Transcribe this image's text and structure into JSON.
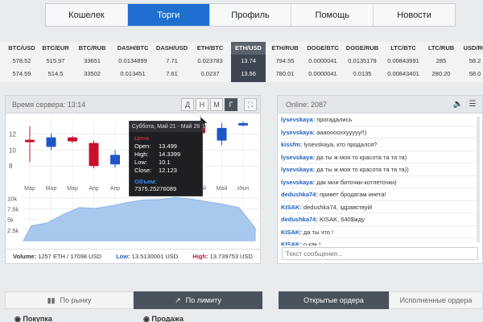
{
  "nav": {
    "tabs": [
      {
        "label": "Кошелек",
        "active": false
      },
      {
        "label": "Торги",
        "active": true
      },
      {
        "label": "Профиль",
        "active": false
      },
      {
        "label": "Помощь",
        "active": false
      },
      {
        "label": "Новости",
        "active": false
      }
    ]
  },
  "ticker": [
    {
      "pair": "BTC/USD",
      "v1": "578.52",
      "v2": "574.59",
      "selected": false
    },
    {
      "pair": "BTC/EUR",
      "v1": "515.97",
      "v2": "514.5",
      "selected": false
    },
    {
      "pair": "BTC/RUB",
      "v1": "33651",
      "v2": "33502",
      "selected": false
    },
    {
      "pair": "DASH/BTC",
      "v1": "0.0134899",
      "v2": "0.013451",
      "selected": false
    },
    {
      "pair": "DASH/USD",
      "v1": "7.71",
      "v2": "7.61",
      "selected": false
    },
    {
      "pair": "ETH/BTC",
      "v1": "0.023783",
      "v2": "0.0237",
      "selected": false
    },
    {
      "pair": "ETH/USD",
      "v1": "13.74",
      "v2": "13.56",
      "selected": true
    },
    {
      "pair": "ETH/RUB",
      "v1": "794.55",
      "v2": "780.01",
      "selected": false
    },
    {
      "pair": "DOGE/BTC",
      "v1": "0.0000041",
      "v2": "0.0000041",
      "selected": false
    },
    {
      "pair": "DOGE/RUB",
      "v1": "0.0135179",
      "v2": "0.0135",
      "selected": false
    },
    {
      "pair": "LTC/BTC",
      "v1": "0.00843991",
      "v2": "0.00843401",
      "selected": false
    },
    {
      "pair": "LTC/RUB",
      "v1": "285",
      "v2": "280.20",
      "selected": false
    },
    {
      "pair": "USD/RU",
      "v1": "58.2",
      "v2": "58.0",
      "selected": false
    }
  ],
  "chart_panel": {
    "server_time": "Время сервера: 13:14",
    "periods": [
      {
        "label": "Д",
        "active": false
      },
      {
        "label": "Н",
        "active": false
      },
      {
        "label": "М",
        "active": false
      },
      {
        "label": "Г",
        "active": true
      }
    ],
    "expand_icon": "expand-icon",
    "footer": {
      "volume_label": "Volume:",
      "volume_value": "1257 ETH / 17098 USD",
      "low_label": "Low:",
      "low_value": "13.5130001 USD",
      "high_label": "High:",
      "high_value": "13.739753 USD"
    },
    "tooltip": {
      "header": "Суббота, Май 21 - Май 28",
      "price_label": "Цена",
      "rows": [
        {
          "k": "Open:",
          "v": "13.499"
        },
        {
          "k": "High:",
          "v": "14.3399"
        },
        {
          "k": "Low:",
          "v": "10.1"
        },
        {
          "k": "Close:",
          "v": "12.123"
        }
      ],
      "volume_label": "Объем:",
      "volume_value": "7375.25276089"
    }
  },
  "chart_data": {
    "type": "candlestick",
    "price_axis": {
      "ticks": [
        12,
        10,
        8
      ],
      "ylim": [
        6.5,
        14
      ]
    },
    "volume_axis": {
      "ticks": [
        "10k",
        "7.5k",
        "5k",
        "2.5k"
      ],
      "ylim": [
        0,
        11000
      ]
    },
    "x_labels": [
      "Мар",
      "Мар",
      "Мар",
      "Апр",
      "Апр",
      "Апр",
      "Май",
      "Май",
      "Май",
      "Май",
      "Июн"
    ],
    "candles": [
      {
        "open": 11.0,
        "close": 11.3,
        "high": 13.0,
        "low": 8.5,
        "color": "#c8102e"
      },
      {
        "open": 10.4,
        "close": 11.6,
        "high": 12.1,
        "low": 10.0,
        "color": "#1e56c8"
      },
      {
        "open": 11.6,
        "close": 11.1,
        "high": 11.8,
        "low": 10.9,
        "color": "#c8102e"
      },
      {
        "open": 10.9,
        "close": 8.0,
        "high": 11.2,
        "low": 7.7,
        "color": "#c8102e"
      },
      {
        "open": 8.2,
        "close": 9.4,
        "high": 10.0,
        "low": 7.8,
        "color": "#1e56c8"
      },
      {
        "open": 9.0,
        "close": 8.1,
        "high": 9.4,
        "low": 7.9,
        "color": "#c8102e"
      },
      {
        "open": 9.5,
        "close": 11.0,
        "high": 12.0,
        "low": 9.0,
        "color": "#1e56c8"
      },
      {
        "open": 11.5,
        "close": 12.8,
        "high": 13.5,
        "low": 11.0,
        "color": "#1e56c8"
      },
      {
        "open": 13.499,
        "close": 12.123,
        "high": 14.3399,
        "low": 10.1,
        "color": "#c8102e"
      },
      {
        "open": 11.2,
        "close": 12.8,
        "high": 13.4,
        "low": 10.6,
        "color": "#1e56c8"
      },
      {
        "open": 13.1,
        "close": 13.4,
        "high": 13.6,
        "low": 13.0,
        "color": "#1e56c8"
      }
    ],
    "volume": [
      3500,
      4200,
      6200,
      7800,
      7600,
      8200,
      9000,
      9600,
      9700,
      10200,
      9800,
      9200,
      8600,
      7800,
      3000
    ]
  },
  "chat": {
    "online": "Online: 2087",
    "sound_icon": "speaker-icon",
    "menu_icon": "menu-icon",
    "messages": [
      {
        "nick": "lysevskaya:",
        "text": " прогадались"
      },
      {
        "nick": "lysevskaya:",
        "text": " аааооооххууууу!!)"
      },
      {
        "nick": "kissfm:",
        "text": " lysevskaya, кто продался?"
      },
      {
        "nick": "lysevskaya:",
        "text": " да ты ж моя то красота та та та)"
      },
      {
        "nick": "lysevskaya:",
        "text": " да ты ж моя то красота та та та))"
      },
      {
        "nick": "lysevskaya:",
        "text": " дак мои биточки-котлеточки)"
      },
      {
        "nick": "dedushka74:",
        "text": " привет бродягам инета!"
      },
      {
        "nick": "KISAK:",
        "text": " dedushka74, здравствуй!"
      },
      {
        "nick": "dedushka74:",
        "text": " KISAK, 640$жду"
      },
      {
        "nick": "KISAK:",
        "text": " да ты что !"
      },
      {
        "nick": "KISAK:",
        "text": " о как !"
      }
    ],
    "input_placeholder": "Текст сообщения..."
  },
  "bottom": {
    "tabs": [
      {
        "label": "По рынку",
        "icon": "bar-chart-icon",
        "active": false
      },
      {
        "label": "По лимиту",
        "icon": "arrow-up-right-icon",
        "active": true
      },
      {
        "label": "Открытые ордера",
        "active": true
      },
      {
        "label": "Исполненные ордера",
        "active": false
      }
    ],
    "buy_heading": "Покупка",
    "sell_heading": "Продажа"
  }
}
